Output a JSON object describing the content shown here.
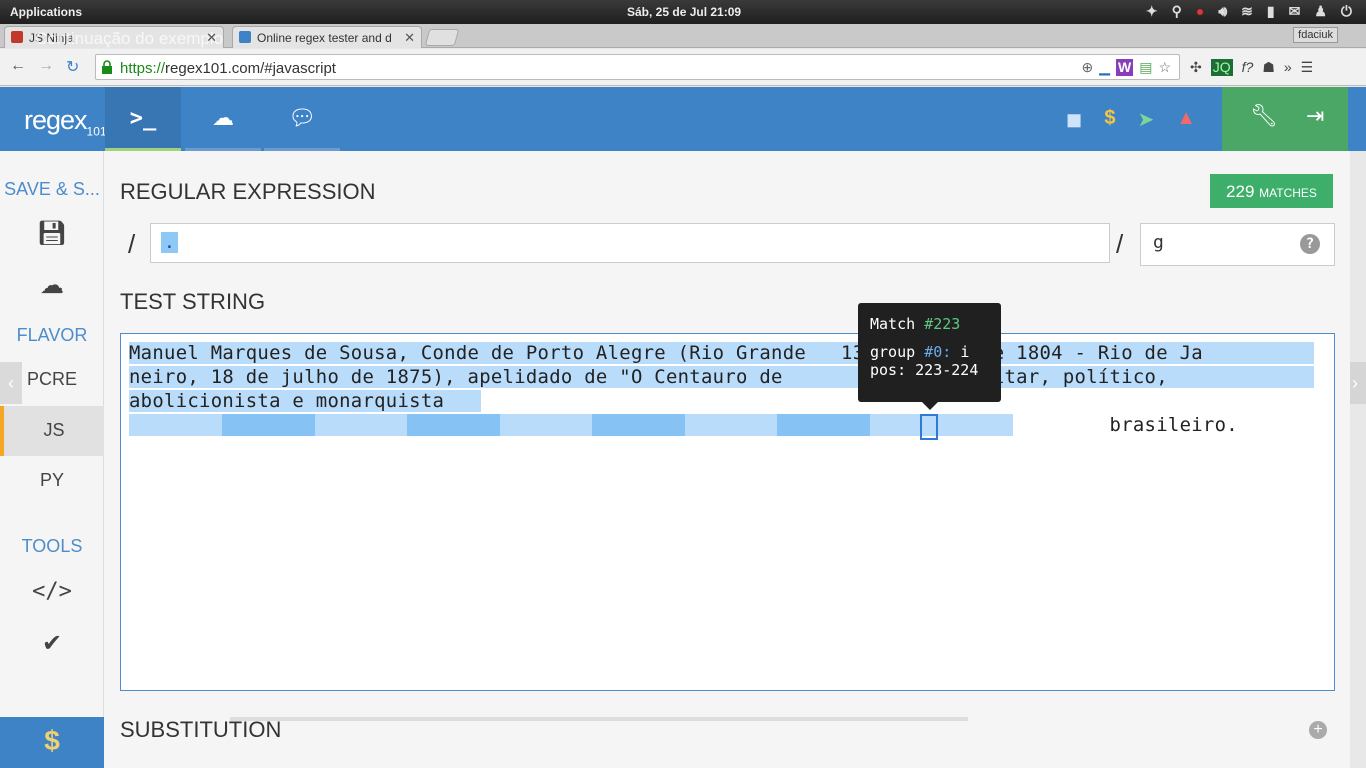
{
  "os": {
    "apps_label": "Applications",
    "clock": "Sáb, 25 de Jul 21:09"
  },
  "browser": {
    "tabs": [
      {
        "title": "JS Ninja",
        "overlay": "Continuação do exemplo"
      },
      {
        "title": "Online regex tester and d"
      }
    ],
    "user_badge": "fdaciuk",
    "url_scheme": "https://",
    "url_rest": "regex101.com/#javascript"
  },
  "header": {
    "logo": "regex",
    "logo_sub": "101"
  },
  "sidebar": {
    "save_title": "SAVE & S...",
    "flavor_title": "FLAVOR",
    "flavors": [
      "PCRE",
      "JS",
      "PY"
    ],
    "tools_title": "TOOLS"
  },
  "main": {
    "regex_title": "REGULAR EXPRESSION",
    "matches_count": "229",
    "matches_label": "MATCHES",
    "slash": "/",
    "regex_value": ".",
    "flags_value": "g",
    "test_title": "TEST STRING",
    "test_lines": [
      "Manuel Marques de Sousa, Conde de Porto Alegre (Rio Grande   13 de junho de 1804 - Rio de Ja",
      "neiro, 18 de julho de 1875), apelidado de \"O Centauro de          i um militar, político,",
      "abolicionista e monarquista",
      "                                                                                    brasileiro."
    ],
    "substitution_title": "SUBSTITUTION"
  },
  "tooltip": {
    "match_label": "Match",
    "match_id": "#223",
    "group_label": "group",
    "group_id": "#0:",
    "group_value": "i",
    "pos_label": "pos:",
    "pos_value": "223-224"
  }
}
